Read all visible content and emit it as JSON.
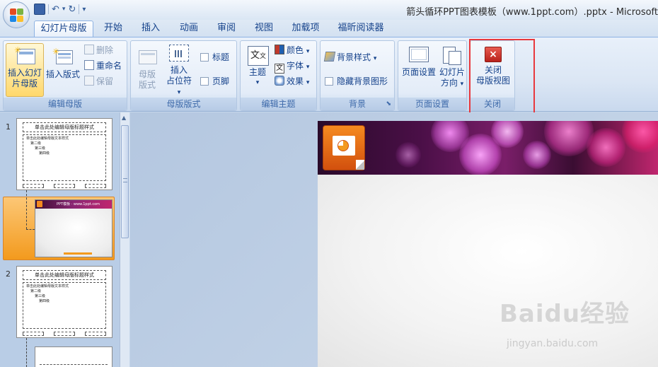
{
  "window": {
    "title": "箭头循环PPT图表模板（www.1ppt.com）.pptx - Microsoft"
  },
  "tabs": [
    "幻灯片母版",
    "开始",
    "插入",
    "动画",
    "审阅",
    "视图",
    "加载项",
    "福昕阅读器"
  ],
  "active_tab": "幻灯片母版",
  "ribbon": {
    "edit_master": {
      "label": "编辑母版",
      "insert_slide_master": "插入幻灯片母版",
      "insert_slide_master_l1": "插入幻灯",
      "insert_slide_master_l2": "片母版",
      "insert_layout": "插入版式",
      "delete": "删除",
      "rename": "重命名",
      "preserve": "保留"
    },
    "master_layout": {
      "label": "母版版式",
      "master_layout_l1": "母版",
      "master_layout_l2": "版式",
      "insert_placeholder_l1": "插入",
      "insert_placeholder_l2": "占位符",
      "title_cb": "标题",
      "footer_cb": "页脚"
    },
    "edit_theme": {
      "label": "编辑主题",
      "theme": "主题",
      "colors": "颜色",
      "fonts": "字体",
      "effects": "效果"
    },
    "background": {
      "label": "背景",
      "bg_styles": "背景样式",
      "hide_bg": "隐藏背景图形"
    },
    "page_setup": {
      "label": "页面设置",
      "page_setup_btn": "页面设置",
      "orientation_l1": "幻灯片",
      "orientation_l2": "方向"
    },
    "close": {
      "label": "关闭",
      "close_l1": "关闭",
      "close_l2": "母版视图"
    }
  },
  "thumbnails": [
    {
      "number": "1",
      "title": "单击此处编辑母版标题样式",
      "body": "单击此处编辑母版文本样式"
    },
    {
      "number": "2",
      "title": "单击此处编辑母版标题样式",
      "body": "单击此处编辑母版文本样式"
    }
  ],
  "sub_levels": [
    "第二级",
    "第三级",
    "第四级"
  ],
  "thumb_layout_header": "PPT模板 · www.1ppt.com",
  "watermark": {
    "main": "Baidu经验",
    "sub": "jingyan.baidu.com"
  },
  "colors": {
    "accent_orange": "#f39a1e",
    "highlight_red": "#e8383d",
    "ribbon_text": "#15428b"
  }
}
